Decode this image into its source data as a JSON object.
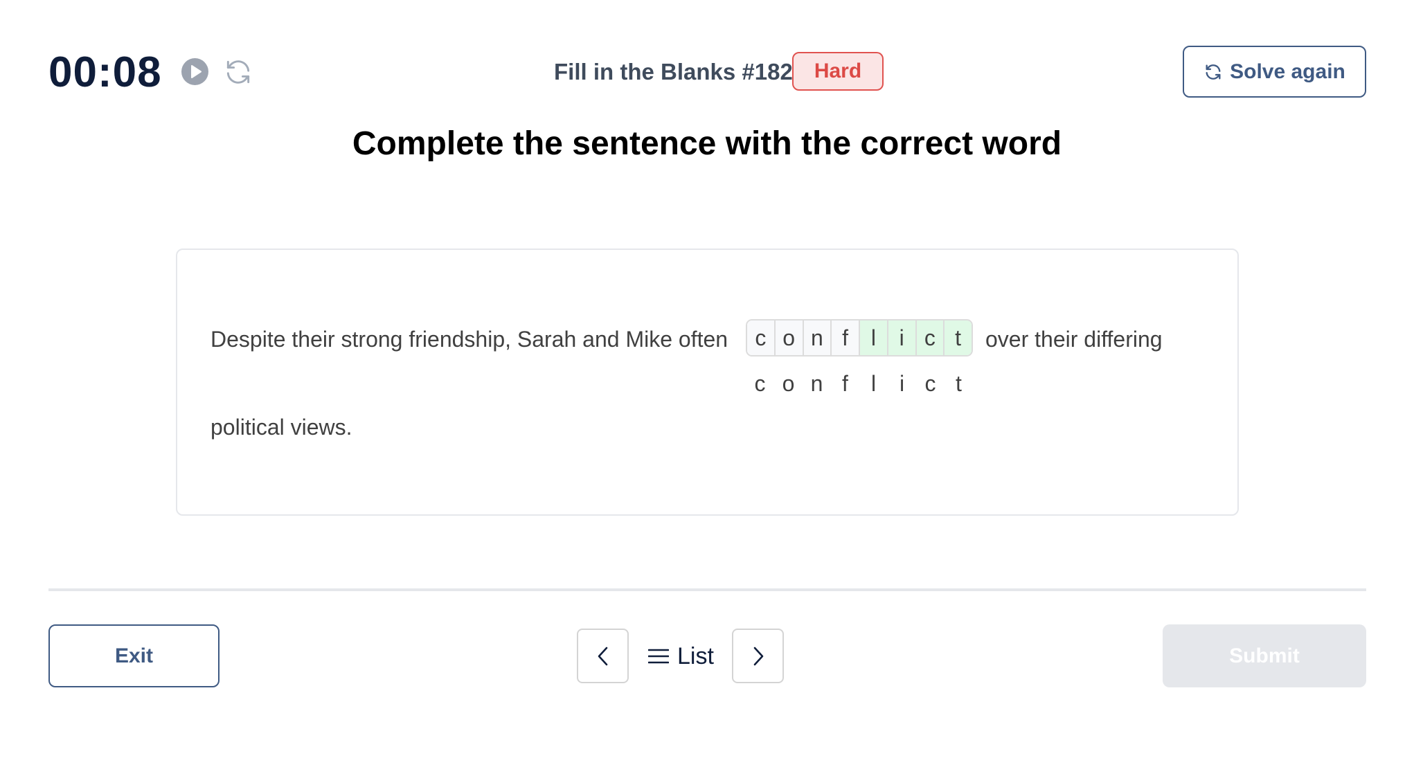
{
  "header": {
    "timer": "00:08",
    "play_icon": "play-circle-icon",
    "reset_icon": "refresh-icon",
    "quiz_title": "Fill in the Blanks #182",
    "difficulty": "Hard",
    "solve_again_label": "Solve again",
    "solve_again_icon": "refresh-icon"
  },
  "heading": "Complete the sentence with the correct word",
  "question": {
    "text_before": "Despite their strong friendship, Sarah and Mike often",
    "text_after": "over their differing",
    "text_end": "political views.",
    "answer_cells": [
      {
        "letter": "c",
        "state": "filled"
      },
      {
        "letter": "o",
        "state": "filled"
      },
      {
        "letter": "n",
        "state": "filled"
      },
      {
        "letter": "f",
        "state": "filled"
      },
      {
        "letter": "l",
        "state": "correct"
      },
      {
        "letter": "i",
        "state": "correct"
      },
      {
        "letter": "c",
        "state": "correct"
      },
      {
        "letter": "t",
        "state": "correct"
      }
    ],
    "hint_letters": [
      "c",
      "o",
      "n",
      "f",
      "l",
      "i",
      "c",
      "t"
    ]
  },
  "footer": {
    "exit_label": "Exit",
    "prev_icon": "chevron-left-icon",
    "list_label": "List",
    "list_icon": "list-icon",
    "next_icon": "chevron-right-icon",
    "submit_label": "Submit"
  },
  "colors": {
    "timer": "#0f1d3a",
    "accent": "#3f5a83",
    "badge_text": "#dc4a46",
    "badge_bg": "#fbe5e5",
    "correct_cell": "#e0f9e6",
    "filled_cell": "#f8f9fb",
    "submit_disabled": "#e5e7eb"
  }
}
